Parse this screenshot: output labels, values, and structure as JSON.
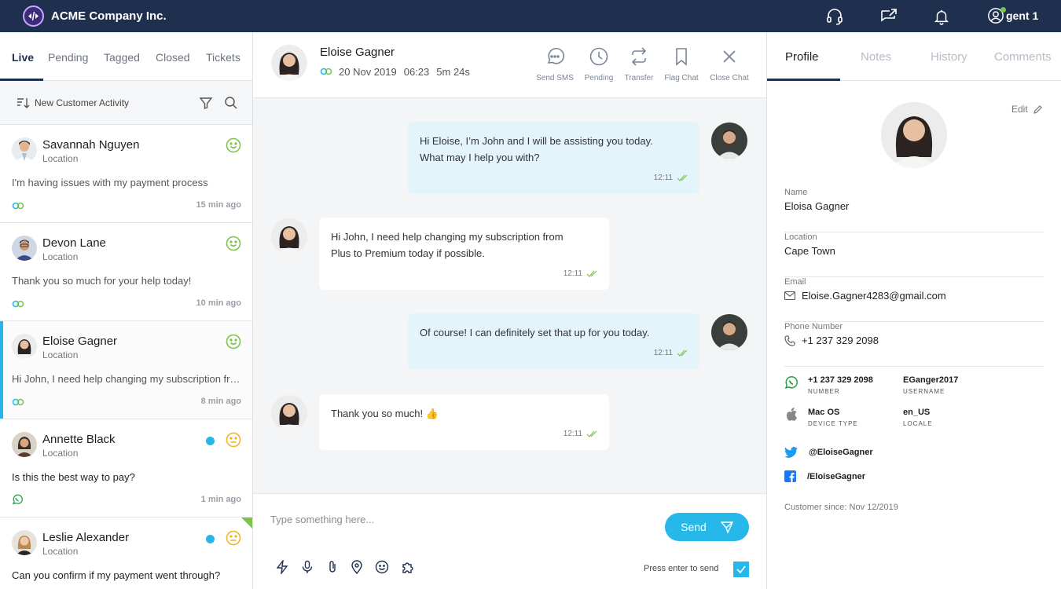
{
  "app": {
    "company": "ACME Company Inc.",
    "agent_name": "gent 1"
  },
  "left_tabs": [
    "Live",
    "Pending",
    "Tagged",
    "Closed",
    "Tickets"
  ],
  "filter": {
    "label": "New Customer Activity"
  },
  "conversations": [
    {
      "name": "Savannah Nguyen",
      "location": "Location",
      "message": "I'm having issues with my payment process",
      "time": "15 min ago"
    },
    {
      "name": "Devon Lane",
      "location": "Location",
      "message": "Thank you so much for your help today!",
      "time": "10 min ago"
    },
    {
      "name": "Eloise Gagner",
      "location": "Location",
      "message": "Hi John, I need help changing my subscription from Plus to Premium today if possible.",
      "time": "8 min ago"
    },
    {
      "name": "Annette Black",
      "location": "Location",
      "message": "Is this the best way to pay?",
      "time": "1 min ago"
    },
    {
      "name": "Leslie Alexander",
      "location": "Location",
      "message": "Can you confirm if my payment went through?",
      "time": ""
    }
  ],
  "chat": {
    "name": "Eloise Gagner",
    "date": "20 Nov 2019",
    "time": "06:23",
    "duration": "5m 24s",
    "actions": [
      "Send SMS",
      "Pending",
      "Transfer",
      "Flag Chat",
      "Close Chat"
    ],
    "messages": [
      {
        "dir": "out",
        "lines": [
          "Hi Eloise, I’m John and I will be assisting you today.",
          "What may I help you with?"
        ],
        "time": "12:11"
      },
      {
        "dir": "in",
        "lines": [
          "Hi John, I need help changing my subscription from",
          "Plus to Premium today if possible."
        ],
        "time": "12:11"
      },
      {
        "dir": "out",
        "lines": [
          "Of course! I can definitely set that up for you today."
        ],
        "time": "12:11"
      },
      {
        "dir": "in",
        "lines": [
          "Thank you so much! 👍"
        ],
        "time": "12:11"
      }
    ],
    "composer_placeholder": "Type something here...",
    "send_label": "Send",
    "enter_label": "Press enter to send"
  },
  "right_tabs": [
    "Profile",
    "Notes",
    "History",
    "Comments"
  ],
  "profile": {
    "edit_label": "Edit",
    "fields": [
      {
        "label": "Name",
        "value": "Eloisa Gagner"
      },
      {
        "label": "Location",
        "value": "Cape Town"
      },
      {
        "label": "Email",
        "value": "Eloise.Gagner4283@gmail.com"
      },
      {
        "label": "Phone  Number",
        "value": "+1 237 329 2098"
      }
    ],
    "whatsapp_number": "+1 237 329 2098",
    "whatsapp_number_label": "NUMBER",
    "username": "EGanger2017",
    "username_label": "USERNAME",
    "device": "Mac OS",
    "device_label": "DEVICE TYPE",
    "locale": "en_US",
    "locale_label": "LOCALE",
    "twitter": "@EloiseGagner",
    "facebook": "/EloiseGagner",
    "since": "Customer since: Nov 12/2019"
  },
  "colors": {
    "navy": "#1f2f4e",
    "accent": "#27b8ea",
    "green": "#7cc44c",
    "amber": "#f0b429"
  }
}
